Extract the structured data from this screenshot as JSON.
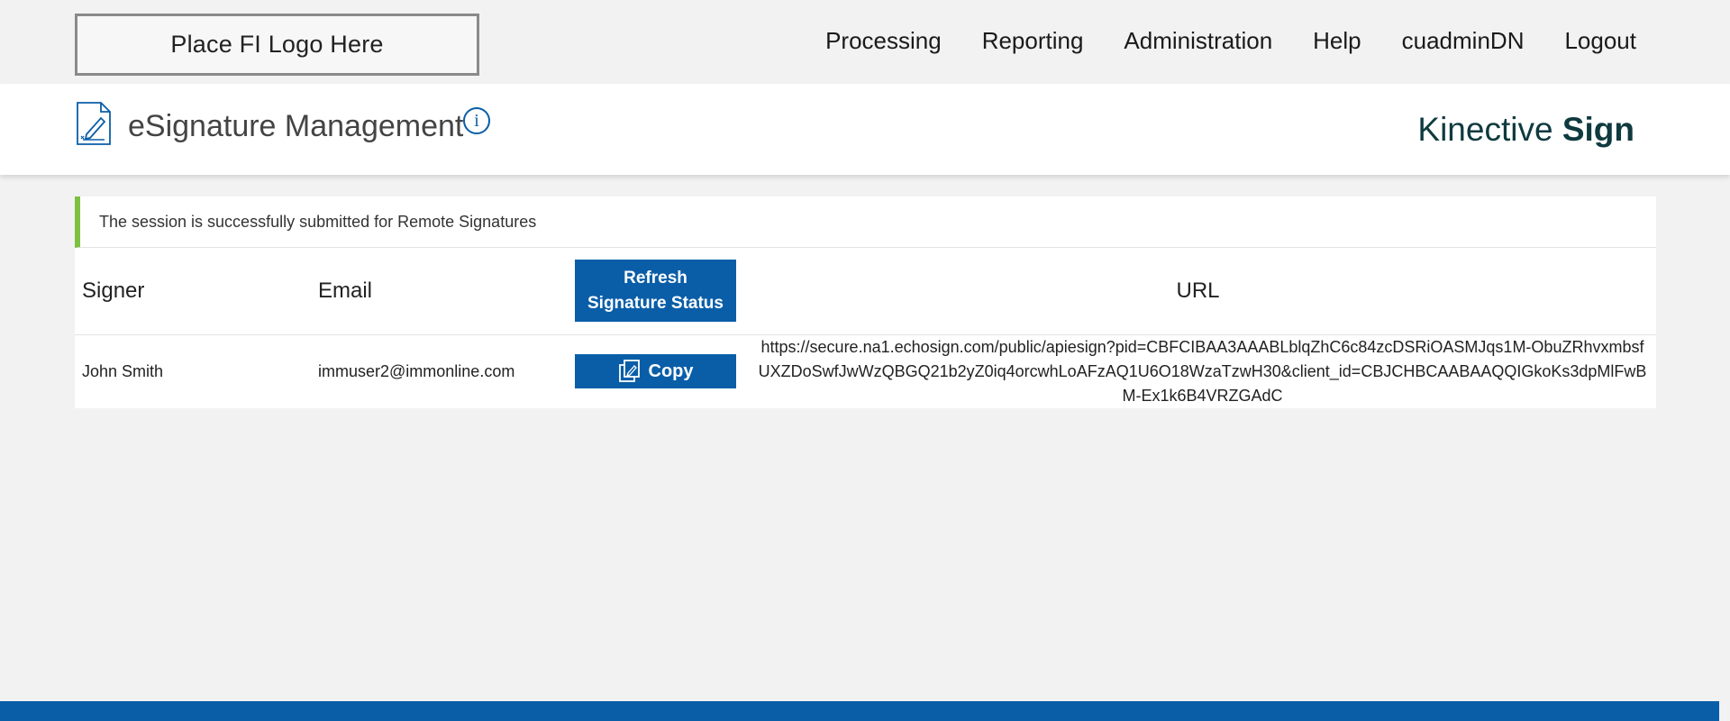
{
  "header": {
    "logo_text": "Place FI Logo Here",
    "nav": [
      {
        "label": "Processing"
      },
      {
        "label": "Reporting"
      },
      {
        "label": "Administration"
      },
      {
        "label": "Help"
      },
      {
        "label": "cuadminDN"
      },
      {
        "label": "Logout"
      }
    ]
  },
  "titlebar": {
    "title": "eSignature Management",
    "info_glyph": "i",
    "brand_regular": "Kinective ",
    "brand_bold": "Sign"
  },
  "alert": {
    "message": "The session is successfully submitted for Remote Signatures",
    "color": "#7cc142"
  },
  "table": {
    "columns": {
      "signer": "Signer",
      "email": "Email",
      "refresh_line1": "Refresh",
      "refresh_line2": "Signature Status",
      "url": "URL"
    },
    "rows": [
      {
        "signer": "John Smith",
        "email": "immuser2@immonline.com",
        "copy_label": "Copy",
        "url": "https://secure.na1.echosign.com/public/apiesign?pid=CBFCIBAA3AAABLblqZhC6c84zcDSRiOASMJqs1M-ObuZRhvxmbsfUXZDoSwfJwWzQBGQ21b2yZ0iq4orcwhLoAFzAQ1U6O18WzaTzwH30&client_id=CBJCHBCAABAAQQIGkoKs3dpMlFwBM-Ex1k6B4VRZGAdC"
      }
    ]
  },
  "colors": {
    "primary": "#0a5ea8",
    "brand_text": "#0f3a3f",
    "background": "#f2f2f2"
  },
  "icons": {
    "title_icon": "document-sign-icon",
    "info_icon": "info-icon",
    "copy_icon": "copy-icon"
  }
}
